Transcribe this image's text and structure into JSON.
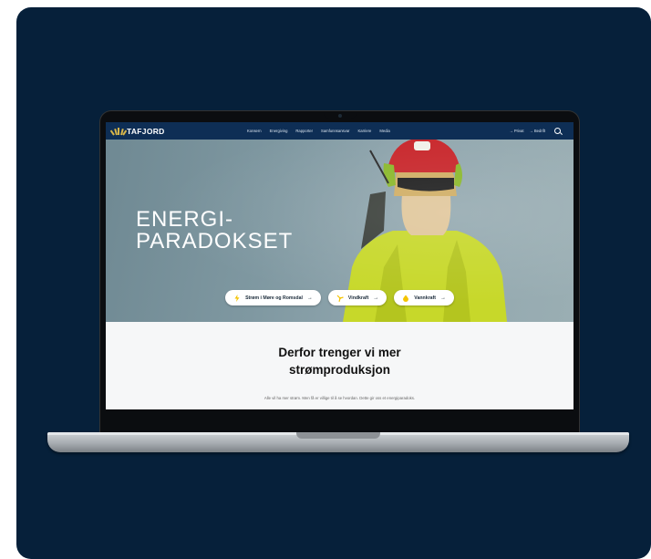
{
  "site": {
    "logo_text": "TAFJORD",
    "nav_items": [
      "Konsern",
      "Energiving",
      "Rapporter",
      "Samfunnsansvar",
      "Karriere",
      "Media"
    ],
    "right_links": [
      "→ Privat",
      "→ Bedrift"
    ]
  },
  "hero": {
    "headline_line1": "ENERGI-",
    "headline_line2": "PARADOKSET",
    "pills": [
      {
        "label": "Strøm i Møre og Romsdal",
        "icon": "lightning-icon"
      },
      {
        "label": "Vindkraft",
        "icon": "wind-turbine-icon"
      },
      {
        "label": "Vannkraft",
        "icon": "water-drop-icon"
      }
    ],
    "arrow": "→"
  },
  "content": {
    "title_line1": "Derfor trenger vi mer",
    "title_line2": "strømproduksjon",
    "subtitle": "Alle vil ha mer strøm. Men få er villige til å se hvordan. Dette gir oss et energiparadoks."
  },
  "colors": {
    "page_background": "#06203a",
    "nav_background": "#0e2e55",
    "accent_yellow": "#f5c400"
  }
}
